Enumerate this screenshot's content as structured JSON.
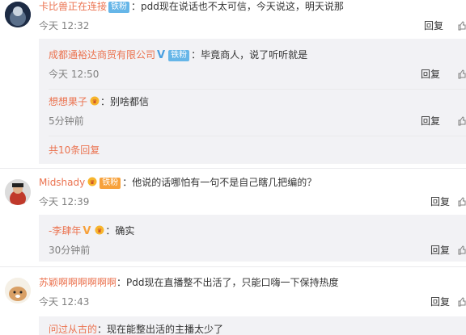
{
  "comments": [
    {
      "user": "卡比兽正在连接",
      "badge": "铁粉",
      "text": "pdd现在说话也不太可信，今天说这，明天说那",
      "time": "今天 12:32",
      "reply_label": "回复",
      "replies": [
        {
          "user": "成都通裕达商贸有限公司",
          "verified": "V",
          "badge": "铁粉",
          "text": "毕竟商人，说了听听就是",
          "time": "今天 12:50",
          "reply_label": "回复"
        },
        {
          "user": "想想果子",
          "text": "别啥都信",
          "time": "5分钟前",
          "reply_label": "回复"
        }
      ],
      "more_replies": "共10条回复"
    },
    {
      "user": "Midshady",
      "badge": "铁粉",
      "text": "他说的话哪怕有一句不是自己瞎几把编的？",
      "time": "今天 12:39",
      "reply_label": "回复",
      "replies": [
        {
          "user": "-李肆年",
          "verified": "V",
          "text": "确实",
          "time": "30分钟前",
          "reply_label": "回复"
        }
      ]
    },
    {
      "user": "苏颖啊啊啊啊啊啊",
      "text": "Pdd现在直播整不出活了，只能口嗨一下保持热度",
      "time": "今天 12:43",
      "reply_label": "回复",
      "replies": [
        {
          "user": "问过从古的",
          "text": "现在能整出活的主播太少了"
        }
      ]
    }
  ],
  "colors": {
    "username": "#eb7350",
    "badge": "#66b6e8",
    "subbox": "#f2f2f5",
    "verified": "#4a9fe0"
  },
  "icons": [
    "avatar",
    "vip-icon",
    "verified-icon",
    "like-icon"
  ]
}
